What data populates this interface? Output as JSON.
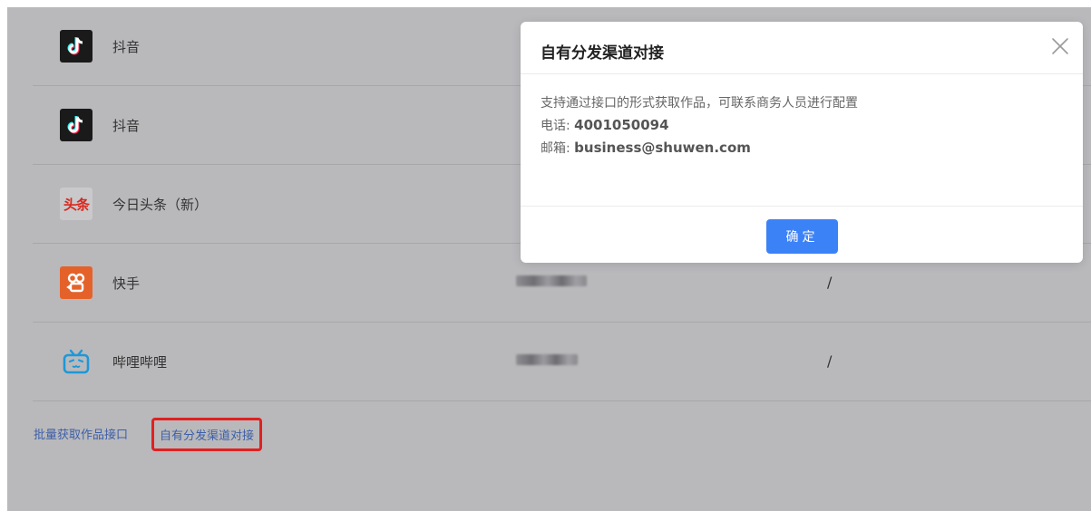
{
  "rows": [
    {
      "name": "抖音",
      "logo": "douyin-logo",
      "value": ""
    },
    {
      "name": "抖音",
      "logo": "douyin-logo",
      "value": ""
    },
    {
      "name": "今日头条（新）",
      "logo": "toutiao-logo",
      "logo_text": "头条",
      "value": ""
    },
    {
      "name": "快手",
      "logo": "kuaishou-logo",
      "value": "/"
    },
    {
      "name": "哔哩哔哩",
      "logo": "bilibili-logo",
      "value": "/"
    }
  ],
  "bottom_links": {
    "batch_api": "批量获取作品接口",
    "own_channel": "自有分发渠道对接"
  },
  "modal": {
    "title": "自有分发渠道对接",
    "description": "支持通过接口的形式获取作品，可联系商务人员进行配置",
    "phone_label": "电话: ",
    "phone": "4001050094",
    "email_label": "邮箱: ",
    "email": "business@shuwen.com",
    "ok_label": "确定"
  },
  "colors": {
    "overlay_bg": "#b9b9bc",
    "primary_button": "#3c82f7",
    "link": "#3d5fa8",
    "highlight_border": "#e02020"
  }
}
